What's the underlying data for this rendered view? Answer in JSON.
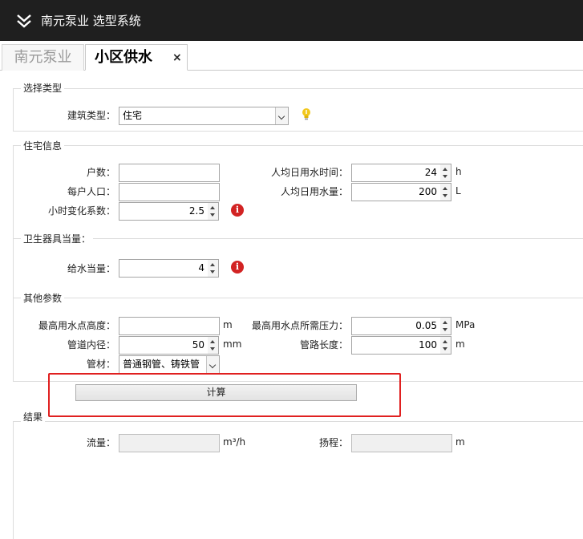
{
  "app": {
    "title": "南元泵业 选型系统",
    "menu_icon": "double-chevron-down-icon"
  },
  "tabs": [
    {
      "label": "南元泵业",
      "active": false
    },
    {
      "label": "小区供水",
      "active": true,
      "close": "×"
    }
  ],
  "select_type": {
    "title": "选择类型",
    "building_type_label": "建筑类型：",
    "building_type_value": "住宅",
    "hint_icon": "lightbulb-icon"
  },
  "residence": {
    "title": "住宅信息",
    "households_label": "户数：",
    "households_value": "",
    "persons_label": "每户人口：",
    "persons_value": "",
    "hourly_coef_label": "小时变化系数：",
    "hourly_coef_value": "2.5",
    "daily_time_label": "人均日用水时间：",
    "daily_time_value": "24",
    "daily_time_unit": "h",
    "daily_volume_label": "人均日用水量：",
    "daily_volume_value": "200",
    "daily_volume_unit": "L"
  },
  "fixtures": {
    "title": "卫生器具当量：",
    "supply_eq_label": "给水当量：",
    "supply_eq_value": "4"
  },
  "other": {
    "title": "其他参数",
    "max_height_label": "最高用水点高度：",
    "max_height_value": "",
    "max_height_unit": "m",
    "max_pressure_label": "最高用水点所需压力：",
    "max_pressure_value": "0.05",
    "max_pressure_unit": "MPa",
    "pipe_diameter_label": "管道内径：",
    "pipe_diameter_value": "50",
    "pipe_diameter_unit": "mm",
    "pipe_length_label": "管路长度：",
    "pipe_length_value": "100",
    "pipe_length_unit": "m",
    "material_label": "管材：",
    "material_value": "普通钢管、铸铁管"
  },
  "actions": {
    "calculate_label": "计算"
  },
  "result": {
    "title": "结果",
    "flow_label": "流量：",
    "flow_value": "",
    "flow_unit": "m³/h",
    "head_label": "扬程：",
    "head_value": "",
    "head_unit": "m"
  },
  "colors": {
    "titlebar": "#1f1f1f",
    "highlight": "#e02020",
    "info": "#d22323",
    "bulb": "#f2c81e"
  }
}
